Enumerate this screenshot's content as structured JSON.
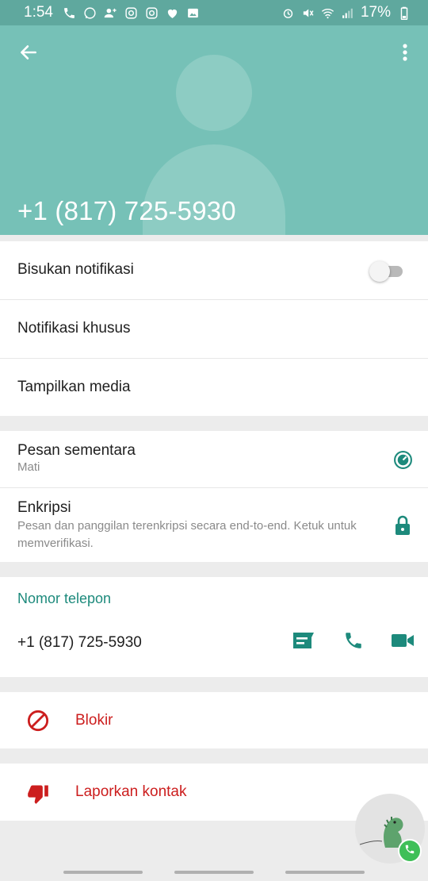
{
  "status_bar": {
    "time": "1:54",
    "battery": "17%"
  },
  "header": {
    "title": "+1 (817) 725-5930"
  },
  "settings": {
    "mute": "Bisukan notifikasi",
    "custom_notif": "Notifikasi khusus",
    "show_media": "Tampilkan media"
  },
  "disappearing": {
    "title": "Pesan sementara",
    "value": "Mati"
  },
  "encryption": {
    "title": "Enkripsi",
    "description": "Pesan dan panggilan terenkripsi secara end-to-end. Ketuk untuk memverifikasi."
  },
  "phone_section": {
    "label": "Nomor telepon",
    "number": "+1 (817) 725-5930"
  },
  "actions": {
    "block": "Blokir",
    "report": "Laporkan kontak"
  },
  "colors": {
    "header_bg": "#76c1b7",
    "status_bar_bg": "#5fa89e",
    "accent": "#1d8a7c",
    "danger": "#cc1e1e"
  }
}
